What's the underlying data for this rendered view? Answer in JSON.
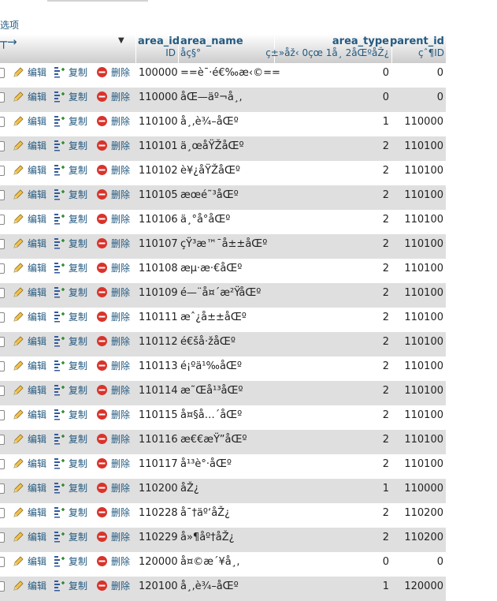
{
  "options_label": "选项",
  "table": {
    "columns": [
      {
        "name": "area_id",
        "comment": "ID"
      },
      {
        "name": "area_name",
        "comment": "åç§°"
      },
      {
        "name": "area_type",
        "comment": "ç±»åž‹ 0çœ 1å¸ 2åŒºåŽ¿"
      },
      {
        "name": "parent_id",
        "comment": "çˆ¶ID"
      }
    ],
    "actions": {
      "edit": "编辑",
      "copy": "复制",
      "delete": "删除"
    },
    "rows": [
      {
        "area_id": "100000",
        "area_name": "==è¯·é€‰æ‹©==",
        "area_type": "0",
        "parent_id": "0"
      },
      {
        "area_id": "110000",
        "area_name": "åŒ—äº¬å¸‚",
        "area_type": "0",
        "parent_id": "0"
      },
      {
        "area_id": "110100",
        "area_name": "å¸‚è¾–åŒº",
        "area_type": "1",
        "parent_id": "110000"
      },
      {
        "area_id": "110101",
        "area_name": "ä¸œåŸŽåŒº",
        "area_type": "2",
        "parent_id": "110100"
      },
      {
        "area_id": "110102",
        "area_name": "è¥¿åŸŽåŒº",
        "area_type": "2",
        "parent_id": "110100"
      },
      {
        "area_id": "110105",
        "area_name": "æœé˜³åŒº",
        "area_type": "2",
        "parent_id": "110100"
      },
      {
        "area_id": "110106",
        "area_name": "ä¸°å°åŒº",
        "area_type": "2",
        "parent_id": "110100"
      },
      {
        "area_id": "110107",
        "area_name": "çŸ³æ™¯å±±åŒº",
        "area_type": "2",
        "parent_id": "110100"
      },
      {
        "area_id": "110108",
        "area_name": "æµ·æ·€åŒº",
        "area_type": "2",
        "parent_id": "110100"
      },
      {
        "area_id": "110109",
        "area_name": "é—¨å¤´æ²ŸåŒº",
        "area_type": "2",
        "parent_id": "110100"
      },
      {
        "area_id": "110111",
        "area_name": "æˆ¿å±±åŒº",
        "area_type": "2",
        "parent_id": "110100"
      },
      {
        "area_id": "110112",
        "area_name": "é€šå·žåŒº",
        "area_type": "2",
        "parent_id": "110100"
      },
      {
        "area_id": "110113",
        "area_name": "é¡ºä¹‰åŒº",
        "area_type": "2",
        "parent_id": "110100"
      },
      {
        "area_id": "110114",
        "area_name": "æ˜Œå¹³åŒº",
        "area_type": "2",
        "parent_id": "110100"
      },
      {
        "area_id": "110115",
        "area_name": "å¤§å…´åŒº",
        "area_type": "2",
        "parent_id": "110100"
      },
      {
        "area_id": "110116",
        "area_name": "æ€€æŸ”åŒº",
        "area_type": "2",
        "parent_id": "110100"
      },
      {
        "area_id": "110117",
        "area_name": "å¹³è°·åŒº",
        "area_type": "2",
        "parent_id": "110100"
      },
      {
        "area_id": "110200",
        "area_name": "åŽ¿",
        "area_type": "1",
        "parent_id": "110000"
      },
      {
        "area_id": "110228",
        "area_name": "å¯†äº‘åŽ¿",
        "area_type": "2",
        "parent_id": "110200"
      },
      {
        "area_id": "110229",
        "area_name": "å»¶åº†åŽ¿",
        "area_type": "2",
        "parent_id": "110200"
      },
      {
        "area_id": "120000",
        "area_name": "å¤©æ´¥å¸‚",
        "area_type": "0",
        "parent_id": "0"
      },
      {
        "area_id": "120100",
        "area_name": "å¸‚è¾–åŒº",
        "area_type": "1",
        "parent_id": "120000"
      }
    ]
  },
  "colors": {
    "link": "#235a81",
    "row_alt": "#dfdfdf",
    "delete_red": "#d9332b"
  }
}
